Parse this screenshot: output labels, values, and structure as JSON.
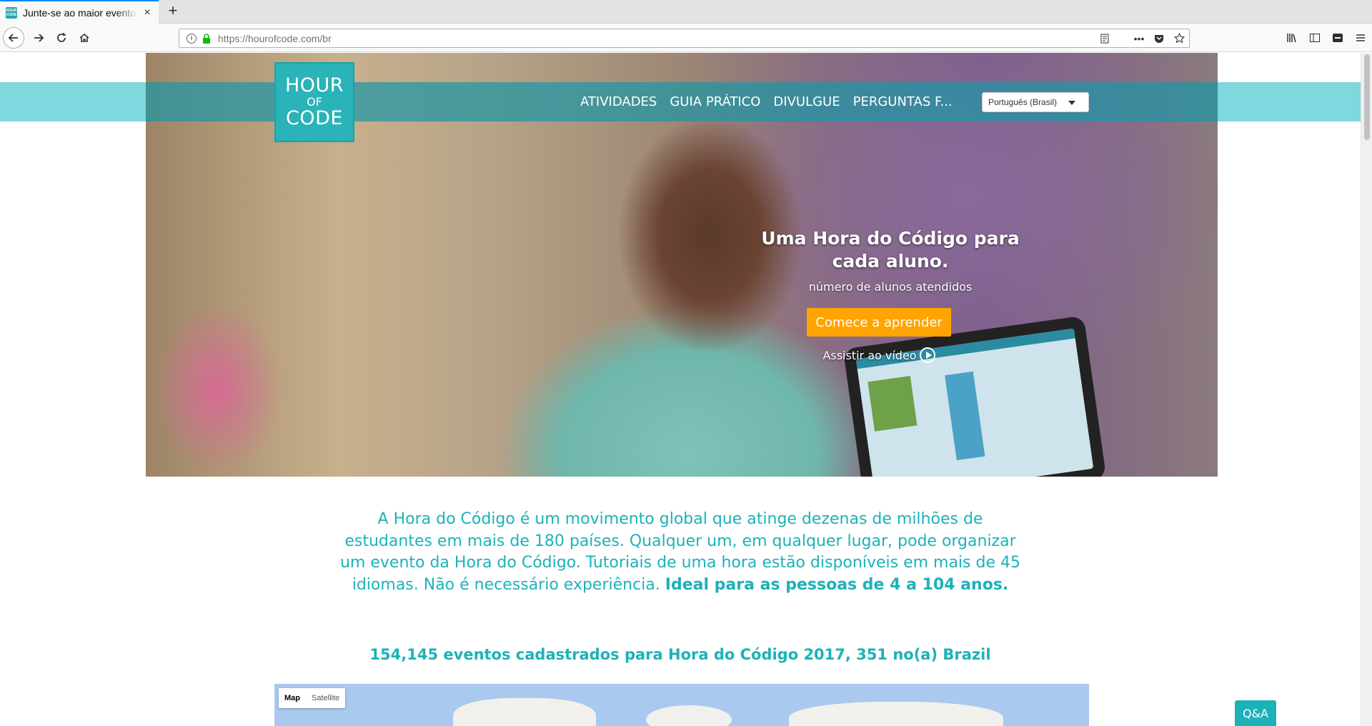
{
  "browser": {
    "tab_title": "Junte-se ao maior evento",
    "url_host": "https://hourofcode.com",
    "url_path": "/br"
  },
  "site": {
    "logo": {
      "line1": "HOUR",
      "line2": "OF",
      "line3": "CODE"
    },
    "nav": [
      {
        "label": "ATIVIDADES"
      },
      {
        "label": "GUIA PRÁTICO"
      },
      {
        "label": "DIVULGUE"
      },
      {
        "label": "PERGUNTAS F..."
      }
    ],
    "language_selected": "Português (Brasil)"
  },
  "hero": {
    "title": "Uma Hora do Código para cada aluno.",
    "subtitle": "número de alunos atendidos",
    "cta_label": "Comece a aprender",
    "watch_label": "Assistir ao vídeo"
  },
  "intro": {
    "text": "A Hora do Código é um movimento global que atinge dezenas de milhões de estudantes em mais de 180 países. Qualquer um, em qualquer lugar, pode organizar um evento da Hora do Código. Tutoriais de uma hora estão disponíveis em mais de 45 idiomas. Não é necessário experiência. ",
    "bold": "Ideal para as pessoas de 4 a 104 anos."
  },
  "events_line": "154,145 eventos cadastrados para Hora do Código 2017, 351 no(a) Brazil",
  "map": {
    "map_label": "Map",
    "satellite_label": "Satellite"
  },
  "qa_label": "Q&A",
  "colors": {
    "teal": "#1cb2b8",
    "teal_band": "#7fd8de",
    "cta_orange": "#ffa400"
  }
}
